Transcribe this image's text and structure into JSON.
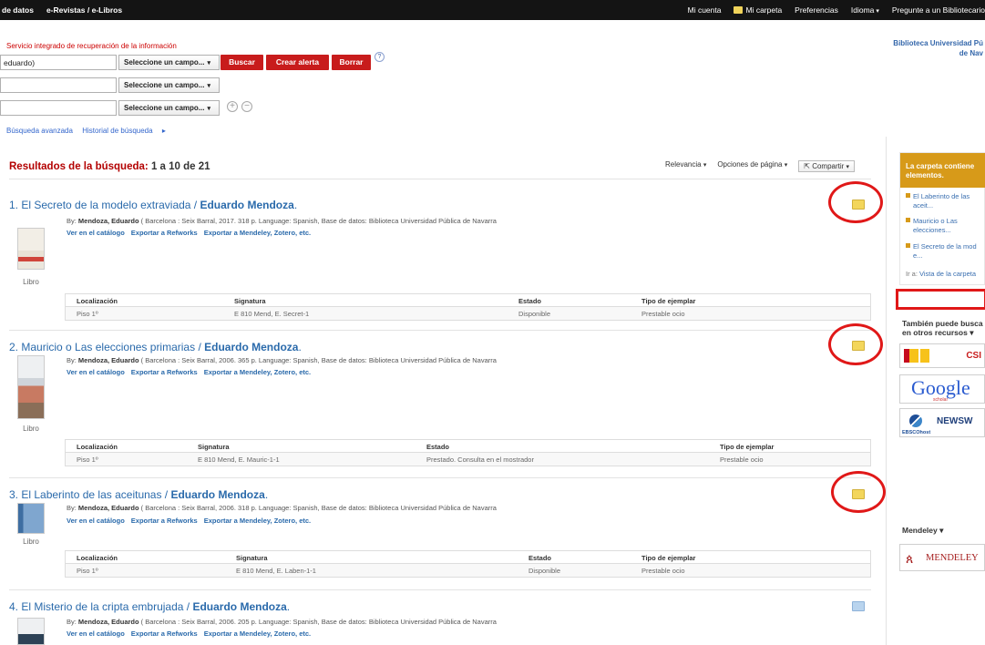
{
  "topbar": {
    "left": [
      "de datos",
      "e-Revistas / e-Libros"
    ],
    "mi_cuenta": "Mi cuenta",
    "mi_carpeta": "Mi carpeta",
    "preferencias": "Preferencias",
    "idioma": "Idioma",
    "pregunte": "Pregunte a un Bibliotecario"
  },
  "search": {
    "subtitle": "Servicio integrado de recuperación de la información",
    "query_value": "eduardo)",
    "field_select": "Seleccione un campo...",
    "buscar": "Buscar",
    "crear_alerta": "Crear alerta",
    "borrar": "Borrar",
    "help": "?",
    "add": "+",
    "remove": "−",
    "advanced": "Búsqueda avanzada",
    "history": "Historial de búsqueda"
  },
  "library_name": [
    "Biblioteca Universidad Pú",
    "de Nav"
  ],
  "results_header": {
    "label": "Resultados de la búsqueda:",
    "count": "1 a 10 de 21",
    "relevancia": "Relevancia",
    "opciones": "Opciones de página",
    "compartir": "Compartir"
  },
  "holdings_headers": {
    "loc": "Localización",
    "sig": "Signatura",
    "estado": "Estado",
    "tipo": "Tipo de ejemplar"
  },
  "actions": {
    "catalogo": "Ver en el catálogo",
    "refworks": "Exportar a Refworks",
    "mendeley": "Exportar a Mendeley, Zotero, etc."
  },
  "results": [
    {
      "num": "1.",
      "title": "El Secreto de la modelo extraviada / ",
      "author": "Eduardo Mendoza",
      "by": "By: ",
      "by_author": "Mendoza, Eduardo",
      "meta": " ( Barcelona : Seix Barral, 2017. 318 p. Language: Spanish, Base de datos: Biblioteca Universidad Pública de Navarra",
      "type": "Libro",
      "holding": {
        "loc": "Piso 1º",
        "sig": "E 810 Mend, E. Secret-1",
        "estado": "Disponible",
        "tipo": "Prestable ocio"
      }
    },
    {
      "num": "2.",
      "title": "Mauricio o Las elecciones primarias / ",
      "author": "Eduardo Mendoza",
      "by": "By: ",
      "by_author": "Mendoza, Eduardo",
      "meta": " ( Barcelona : Seix Barral, 2006. 365 p. Language: Spanish, Base de datos: Biblioteca Universidad Pública de Navarra",
      "type": "Libro",
      "holding": {
        "loc": "Piso 1º",
        "sig": "E 810 Mend, E. Mauric-1-1",
        "estado": "Prestado. Consulta en el mostrador",
        "tipo": "Prestable ocio"
      }
    },
    {
      "num": "3.",
      "title": "El Laberinto de las aceitunas / ",
      "author": "Eduardo Mendoza",
      "by": "By: ",
      "by_author": "Mendoza, Eduardo",
      "meta": " ( Barcelona : Seix Barral, 2006. 318 p. Language: Spanish, Base de datos: Biblioteca Universidad Pública de Navarra",
      "type": "Libro",
      "holding": {
        "loc": "Piso 1º",
        "sig": "E 810 Mend, E. Laben-1-1",
        "estado": "Disponible",
        "tipo": "Prestable ocio"
      }
    },
    {
      "num": "4.",
      "title": "El Misterio de la cripta embrujada / ",
      "author": "Eduardo Mendoza",
      "by": "By: ",
      "by_author": "Mendoza, Eduardo",
      "meta": " ( Barcelona : Seix Barral, 2006. 205 p. Language: Spanish, Base de datos: Biblioteca Universidad Pública de Navarra"
    }
  ],
  "folder_box": {
    "header": "La carpeta contiene elementos.",
    "items": [
      [
        "El Laberinto de las",
        "aceit..."
      ],
      [
        "Mauricio o Las",
        "elecciones..."
      ],
      [
        "El Secreto de la mod",
        "e..."
      ]
    ],
    "link_prefix": "Ir a: ",
    "link": "Vista de la carpeta"
  },
  "also_search": [
    "También puede busca",
    "en otros recursos"
  ],
  "resources": {
    "csic": "CSI",
    "google": "Google",
    "google_sub": "scholar",
    "newsweb": "NEWSW",
    "ebsco": "EBSCOhost"
  },
  "mendeley": {
    "heading": "Mendeley",
    "logo": "MENDELEY"
  },
  "colors": {
    "accent_red": "#c81c1c",
    "link_blue": "#2a6aab",
    "folder_orange": "#d79a19",
    "highlight_red": "#e01818"
  }
}
